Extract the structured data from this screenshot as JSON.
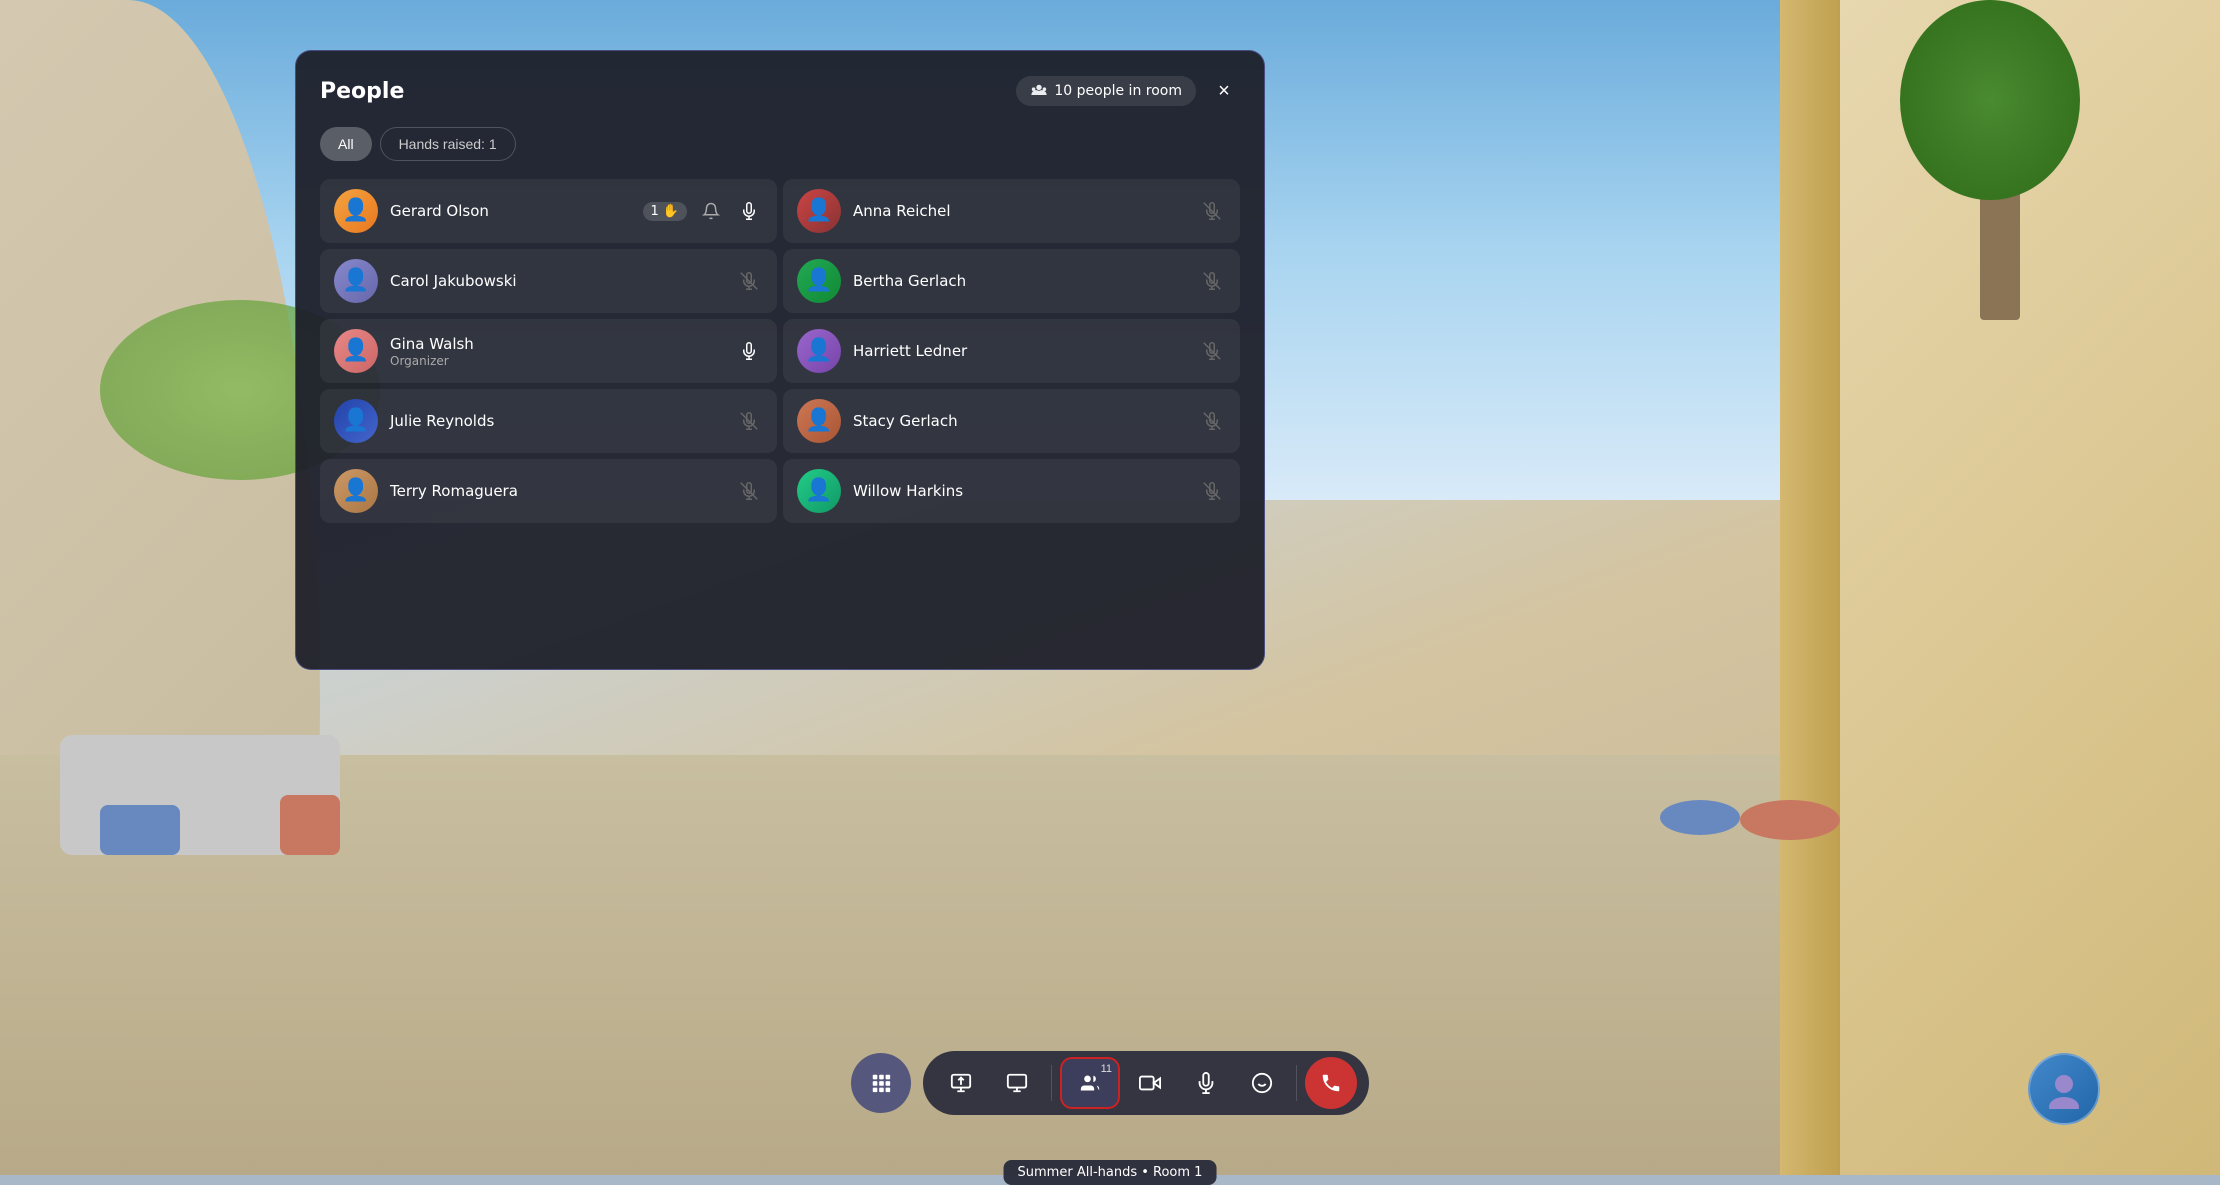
{
  "background": {
    "sky_color": "#6aabdb",
    "floor_color": "#c8bea0"
  },
  "panel": {
    "title": "People",
    "close_label": "×",
    "people_count": "10 people in room",
    "filters": [
      {
        "id": "all",
        "label": "All",
        "active": true
      },
      {
        "id": "hands",
        "label": "Hands raised: 1",
        "active": false
      }
    ],
    "people": [
      {
        "id": "gerard",
        "name": "Gerard Olson",
        "role": "",
        "hand_raised": true,
        "hand_count": "1",
        "mic": "on",
        "notify": true,
        "column": "left"
      },
      {
        "id": "anna",
        "name": "Anna Reichel",
        "role": "",
        "hand_raised": false,
        "mic": "off",
        "column": "right"
      },
      {
        "id": "carol",
        "name": "Carol Jakubowski",
        "role": "",
        "hand_raised": false,
        "mic": "off",
        "column": "left"
      },
      {
        "id": "bertha",
        "name": "Bertha Gerlach",
        "role": "",
        "hand_raised": false,
        "mic": "off",
        "column": "right"
      },
      {
        "id": "gina",
        "name": "Gina Walsh",
        "role": "Organizer",
        "hand_raised": false,
        "mic": "on",
        "column": "left"
      },
      {
        "id": "harriett",
        "name": "Harriett Ledner",
        "role": "",
        "hand_raised": false,
        "mic": "off",
        "column": "right"
      },
      {
        "id": "julie",
        "name": "Julie Reynolds",
        "role": "",
        "hand_raised": false,
        "mic": "off",
        "column": "left"
      },
      {
        "id": "stacy",
        "name": "Stacy Gerlach",
        "role": "",
        "hand_raised": false,
        "mic": "off",
        "column": "right"
      },
      {
        "id": "terry",
        "name": "Terry Romaguera",
        "role": "",
        "hand_raised": false,
        "mic": "off",
        "column": "left"
      },
      {
        "id": "willow",
        "name": "Willow Harkins",
        "role": "",
        "hand_raised": false,
        "mic": "off",
        "column": "right"
      }
    ]
  },
  "toolbar": {
    "apps_label": "⋮⋮⋮",
    "share_label": "Share",
    "media_label": "Media",
    "people_label": "People",
    "people_count": "11",
    "camera_label": "Camera",
    "mic_label": "Mic",
    "emoji_label": "React",
    "end_label": "Leave",
    "tooltip": "Summer All-hands • Room 1"
  }
}
